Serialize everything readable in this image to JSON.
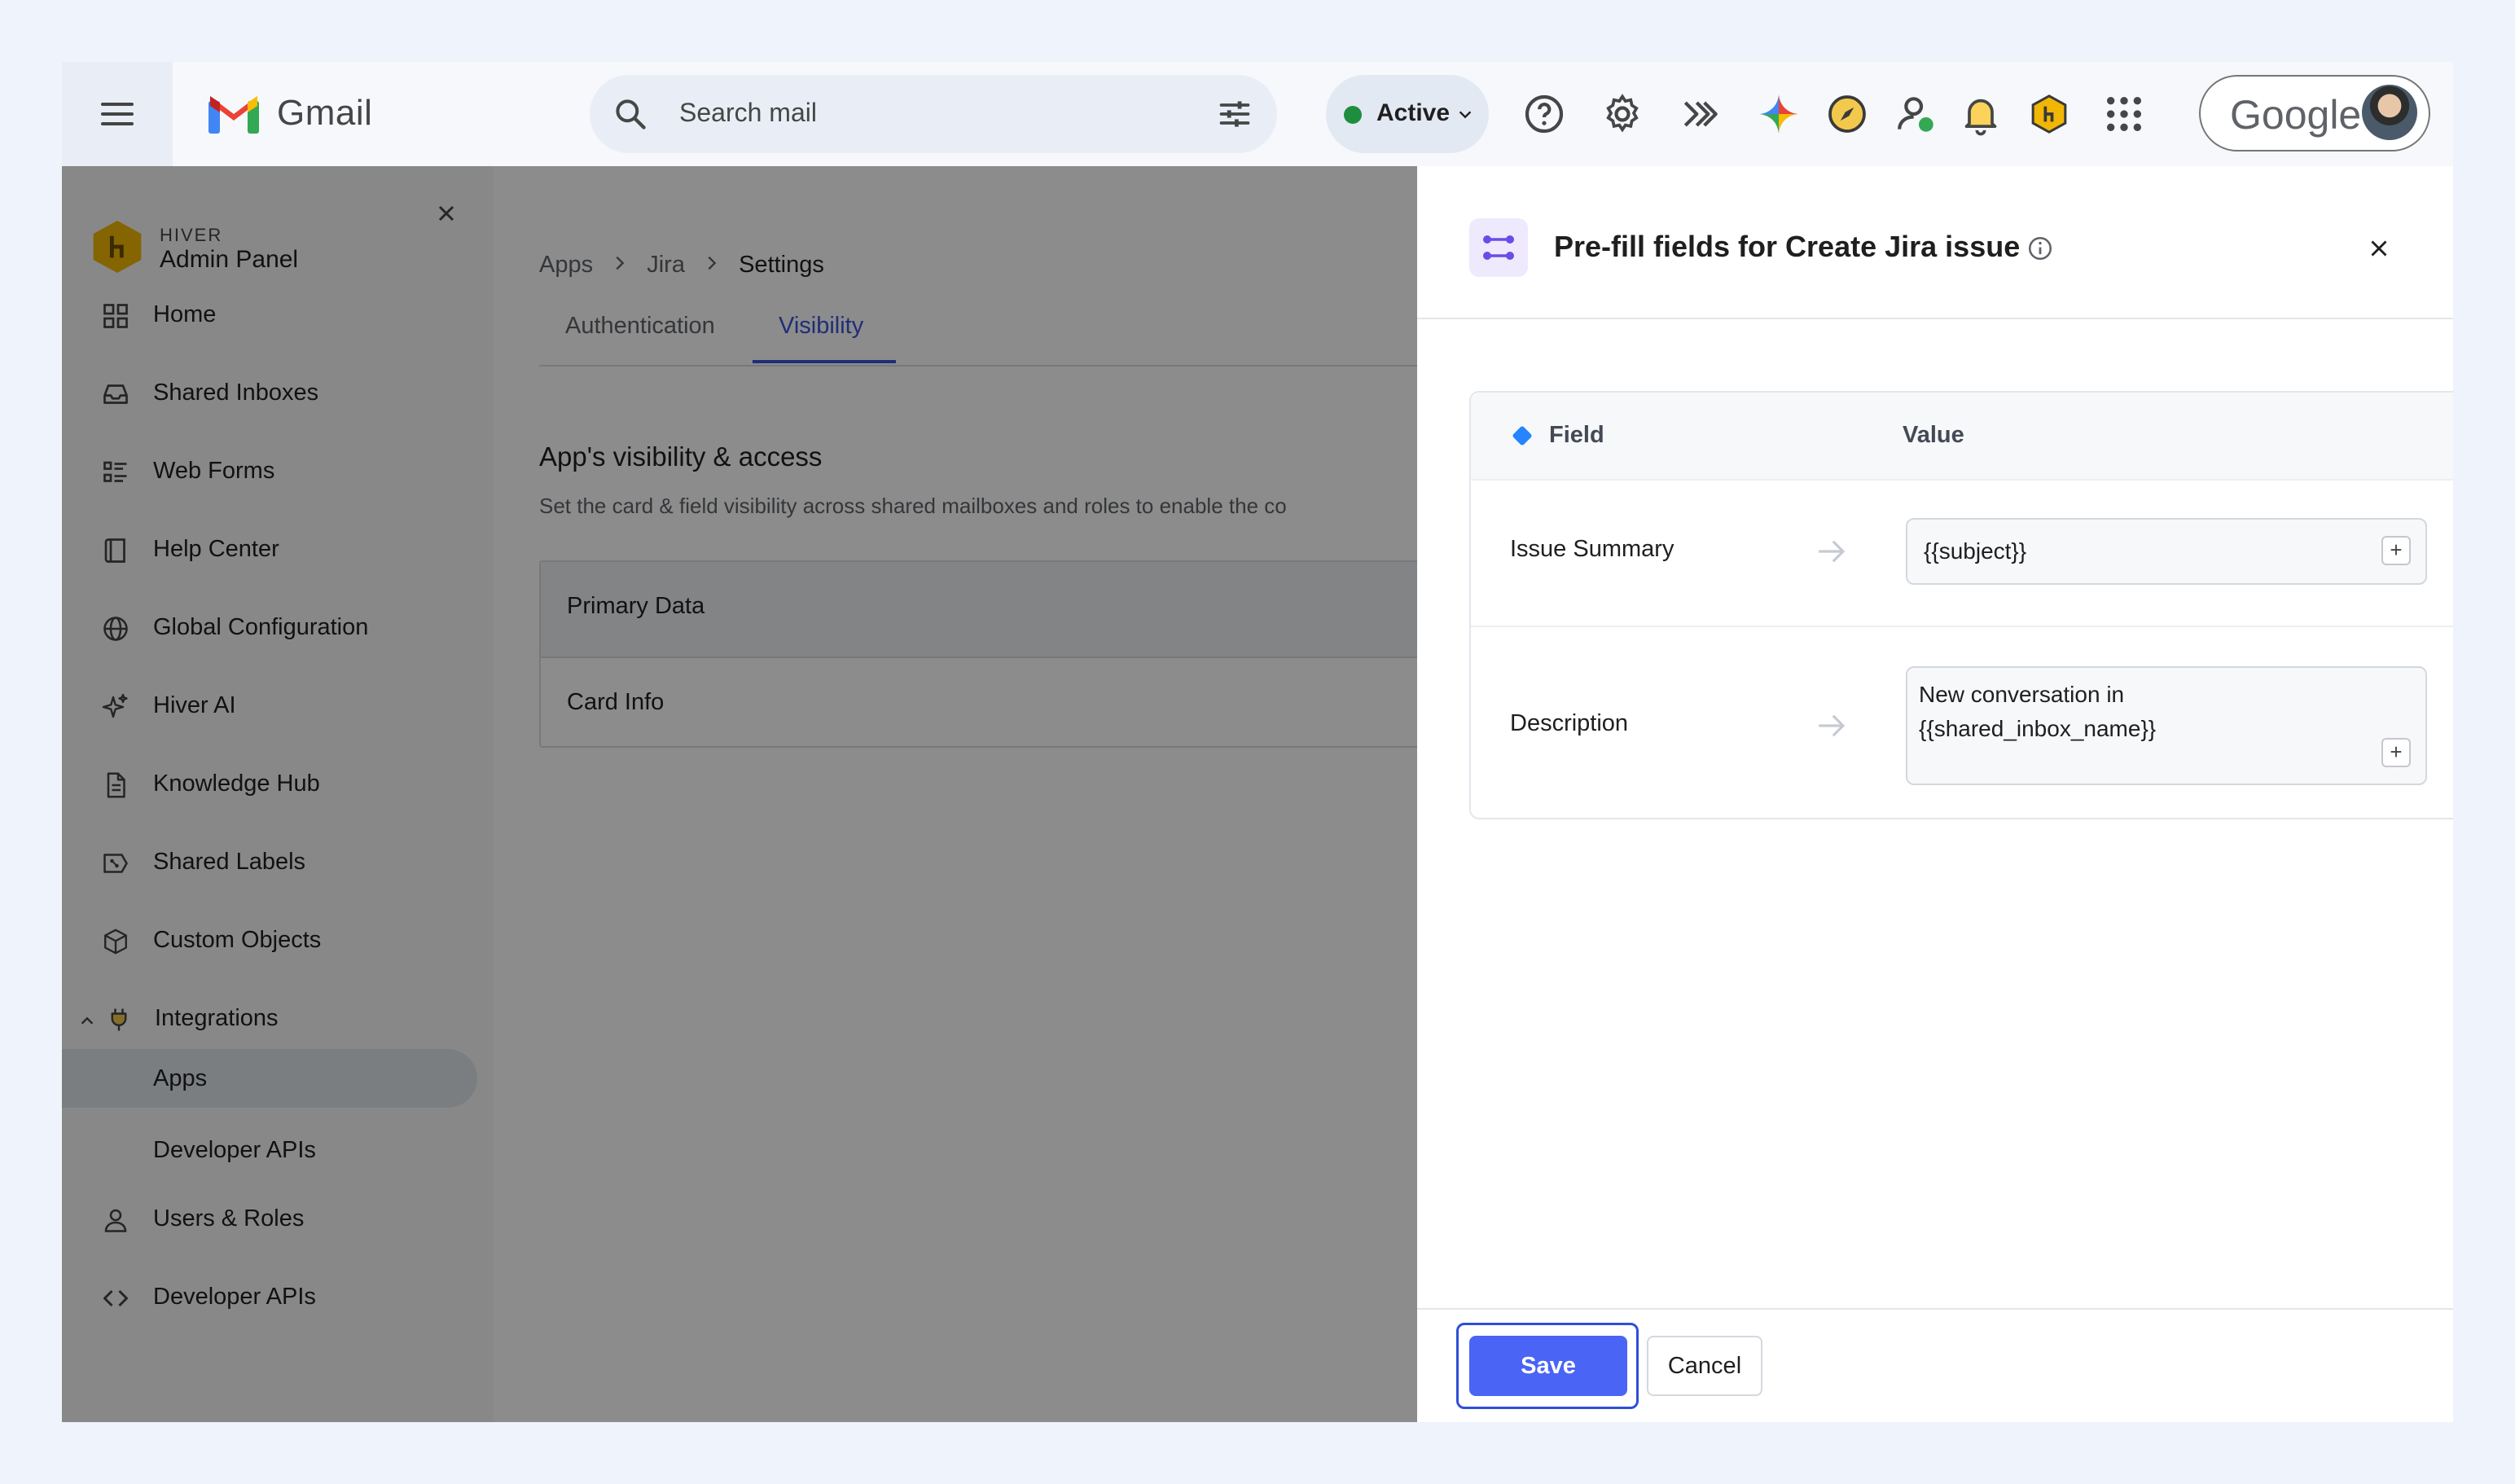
{
  "gmail": {
    "app_name": "Gmail",
    "search_placeholder": "Search mail",
    "status_label": "Active",
    "account_label": "Google"
  },
  "sidebar": {
    "brand_small": "HIVER",
    "brand_title": "Admin Panel",
    "items": [
      {
        "label": "Home",
        "icon": "grid-icon"
      },
      {
        "label": "Shared Inboxes",
        "icon": "inbox-icon"
      },
      {
        "label": "Web Forms",
        "icon": "form-icon"
      },
      {
        "label": "Help Center",
        "icon": "book-icon"
      },
      {
        "label": "Global Configuration",
        "icon": "globe-icon"
      },
      {
        "label": "Hiver AI",
        "icon": "sparkle-icon"
      },
      {
        "label": "Knowledge Hub",
        "icon": "document-icon"
      },
      {
        "label": "Shared Labels",
        "icon": "label-icon"
      },
      {
        "label": "Custom Objects",
        "icon": "cube-icon"
      },
      {
        "label": "Integrations",
        "icon": "plug-icon"
      }
    ],
    "sub_items": [
      {
        "label": "Apps"
      },
      {
        "label": "Developer APIs"
      }
    ],
    "bottom_items": [
      {
        "label": "Users & Roles",
        "icon": "user-icon"
      },
      {
        "label": "Developer APIs",
        "icon": "code-icon"
      }
    ]
  },
  "main": {
    "breadcrumb": [
      "Apps",
      "Jira",
      "Settings"
    ],
    "tabs": [
      {
        "label": "Authentication"
      },
      {
        "label": "Visibility"
      }
    ],
    "section_title": "App's visibility & access",
    "section_desc": "Set the card & field visibility across shared mailboxes and roles to enable the co",
    "card_header": "Primary Data",
    "card_row": "Card Info"
  },
  "panel": {
    "title": "Pre-fill fields for Create Jira issue",
    "col_field": "Field",
    "col_value": "Value",
    "rows": [
      {
        "field": "Issue Summary",
        "value": "{{subject}}"
      },
      {
        "field": "Description",
        "value_line1": "New conversation in",
        "value_line2": "{{shared_inbox_name}}"
      }
    ],
    "save_label": "Save",
    "cancel_label": "Cancel"
  },
  "colors": {
    "accent": "#4a64f5",
    "tab_active": "#3a55d9",
    "status_green": "#1e8e3e",
    "jira_blue": "#2684ff",
    "hiver_yellow": "#f2b705"
  }
}
